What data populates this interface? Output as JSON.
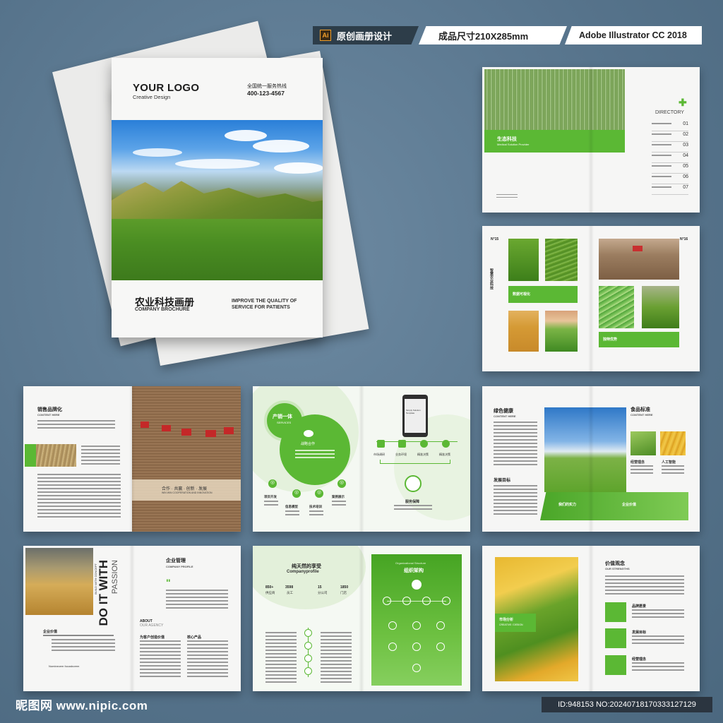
{
  "tags": {
    "software_icon": "Ai",
    "design_label": "原创画册设计",
    "size_label": "成品尺寸210X285mm",
    "software_label": "Adobe Illustrator CC 2018"
  },
  "cover": {
    "logo": "YOUR LOGO",
    "logo_sub": "Creative Design",
    "hotline_label": "全国统一服务热线",
    "phone": "400-123-4567",
    "title": "农业科技画册",
    "title_en": "COMPANY BROCHURE",
    "slogan": "IMPROVE THE QUALITY OF SERVICE FOR PATIENTS"
  },
  "page_directory": {
    "banner_title": "生态科技",
    "banner_sub": "Medical Solution Provider",
    "directory_label": "DIRECTORY",
    "items": [
      "01",
      "02",
      "03",
      "04",
      "05",
      "06",
      "07"
    ]
  },
  "page_gallery": {
    "page_left": "N°15",
    "page_right": "N°16",
    "vertical_title": "智慧农业科技",
    "label_1": "数据可视化",
    "label_2": "独特优势"
  },
  "page_brand": {
    "heading": "销售品牌化",
    "sub": "CONTENT HERE",
    "caption": "合作 · 共赢 · 创新 · 发展",
    "caption_en": "WIN WIN COOPERATION AND INNOVATION"
  },
  "page_process": {
    "circle_title": "产销一体",
    "circle_sub": "SERVICES",
    "bubble_label": "战略合作",
    "labels": [
      "项目开发",
      "信息模型",
      "技术培训",
      "案例展示"
    ],
    "phone_text": "Simply Solution Template",
    "flow": [
      "市场调研",
      "业务环境",
      "精准决策",
      "精准决策"
    ],
    "service": "服务保障"
  },
  "page_health": {
    "heading_left": "绿色健康",
    "sub_left": "CONTENT HERE",
    "heading_right": "食品标准",
    "sub_right": "CONTENT HERE",
    "label_1": "经营理念",
    "label_2": "人工智能",
    "goal": "发展目标",
    "strength": "我们的实力",
    "team": "企业价值"
  },
  "page_profile": {
    "vertical": "DO IT WITH",
    "vertical_2": "PASSION",
    "vertical_3": "BUILD WITH CONCEPT",
    "heading": "企业管理",
    "sub": "COMPANY PROFILE",
    "about": "ABOUT",
    "about_sub": "OUR AGENCY",
    "value": "企业价值",
    "col_1": "为客户创造价值",
    "col_2": "核心产品",
    "sign": "Nominecem focusborem"
  },
  "page_org": {
    "title": "纯天然的享受",
    "sub": "Companyprofile",
    "stats": [
      {
        "value": "850+",
        "label": "供应商"
      },
      {
        "value": "3598",
        "label": "员工"
      },
      {
        "value": "15",
        "label": "分公司"
      },
      {
        "value": "1850",
        "label": "门店"
      }
    ],
    "org_title": "组织架构",
    "org_sub": "Organizational Structure"
  },
  "page_values": {
    "heading": "价值观念",
    "sub": "OUR STRENGTHS",
    "market": "市场分析",
    "market_sub": "CREATIVE / DESIGN",
    "items": [
      "品牌愿景",
      "发展目标",
      "经营理念"
    ]
  },
  "footer": {
    "watermark": "昵图网 www.nipic.com",
    "id_text": "ID:948153 NO:20240718170333127129"
  }
}
